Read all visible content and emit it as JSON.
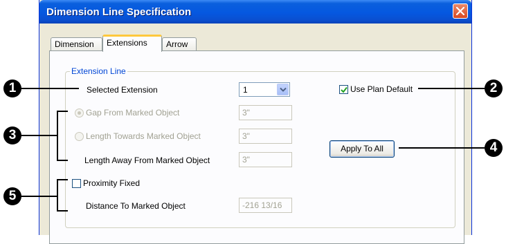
{
  "dialog": {
    "title": "Dimension Line Specification",
    "tabs": [
      "Dimension",
      "Extensions",
      "Arrow"
    ],
    "active_tab": "Extensions"
  },
  "group": {
    "label": "Extension Line"
  },
  "fields": {
    "selected_extension": {
      "label": "Selected Extension",
      "value": "1"
    },
    "gap_from_marked": {
      "label": "Gap From Marked Object",
      "value": "3\""
    },
    "length_towards": {
      "label": "Length Towards Marked Object",
      "value": "3\""
    },
    "length_away": {
      "label": "Length Away From Marked Object",
      "value": "3\""
    },
    "proximity_fixed": {
      "label": "Proximity Fixed",
      "checked": false
    },
    "distance_to_marked": {
      "label": "Distance To Marked Object",
      "value": "-216 13/16"
    },
    "use_plan_default": {
      "label": "Use Plan Default",
      "checked": true
    }
  },
  "buttons": {
    "apply_to_all": "Apply To All"
  },
  "callouts": [
    "1",
    "2",
    "3",
    "4",
    "5"
  ],
  "colors": {
    "title_bar": "#0558e0",
    "group_label": "#0046d5",
    "disabled_text": "#a1a192"
  }
}
